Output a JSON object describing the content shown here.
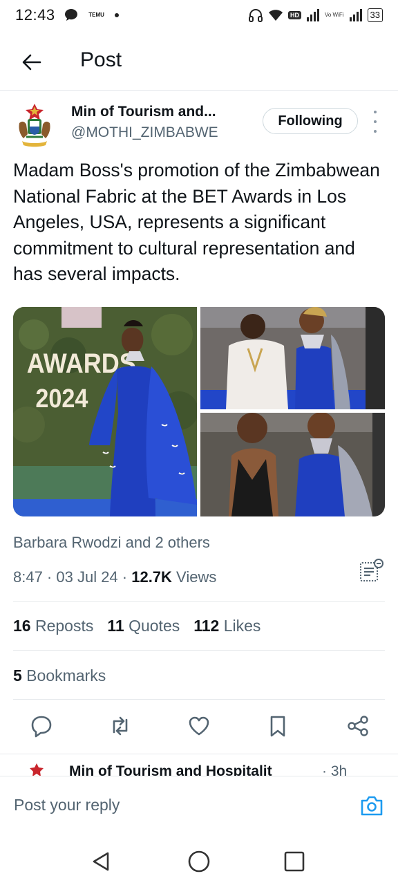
{
  "status_bar": {
    "time": "12:43",
    "temu_label": "TEMU",
    "hd_label": "HD",
    "vowifi_label": "Vo WiFi",
    "battery": "33"
  },
  "header": {
    "title": "Post"
  },
  "post": {
    "author_name": "Min of Tourism and...",
    "author_handle": "@MOTHI_ZIMBABWE",
    "follow_label": "Following",
    "text": "Madam Boss's promotion of the Zimbabwean National Fabric at the BET Awards in Los Angeles, USA, represents a significant commitment to cultural representation and has several impacts.",
    "media": {
      "main_sign_line1": "AWARDS",
      "main_sign_line2": "2024"
    },
    "tagged": "Barbara Rwodzi and 2 others",
    "timestamp": "8:47 · 03 Jul 24 · ",
    "views_count": "12.7K",
    "views_label": " Views",
    "reposts_count": "16",
    "reposts_label": " Reposts",
    "quotes_count": "11",
    "quotes_label": " Quotes",
    "likes_count": "112",
    "likes_label": " Likes",
    "bookmarks_count": "5",
    "bookmarks_label": " Bookmarks"
  },
  "next_post": {
    "author_name": "Min of Tourism and Hospitalit",
    "time": "· 3h"
  },
  "reply": {
    "placeholder": "Post your reply"
  },
  "colors": {
    "accent": "#1d9bf0",
    "text_primary": "#0f1419",
    "text_secondary": "#536471",
    "dress_blue": "#1f3fbf"
  }
}
